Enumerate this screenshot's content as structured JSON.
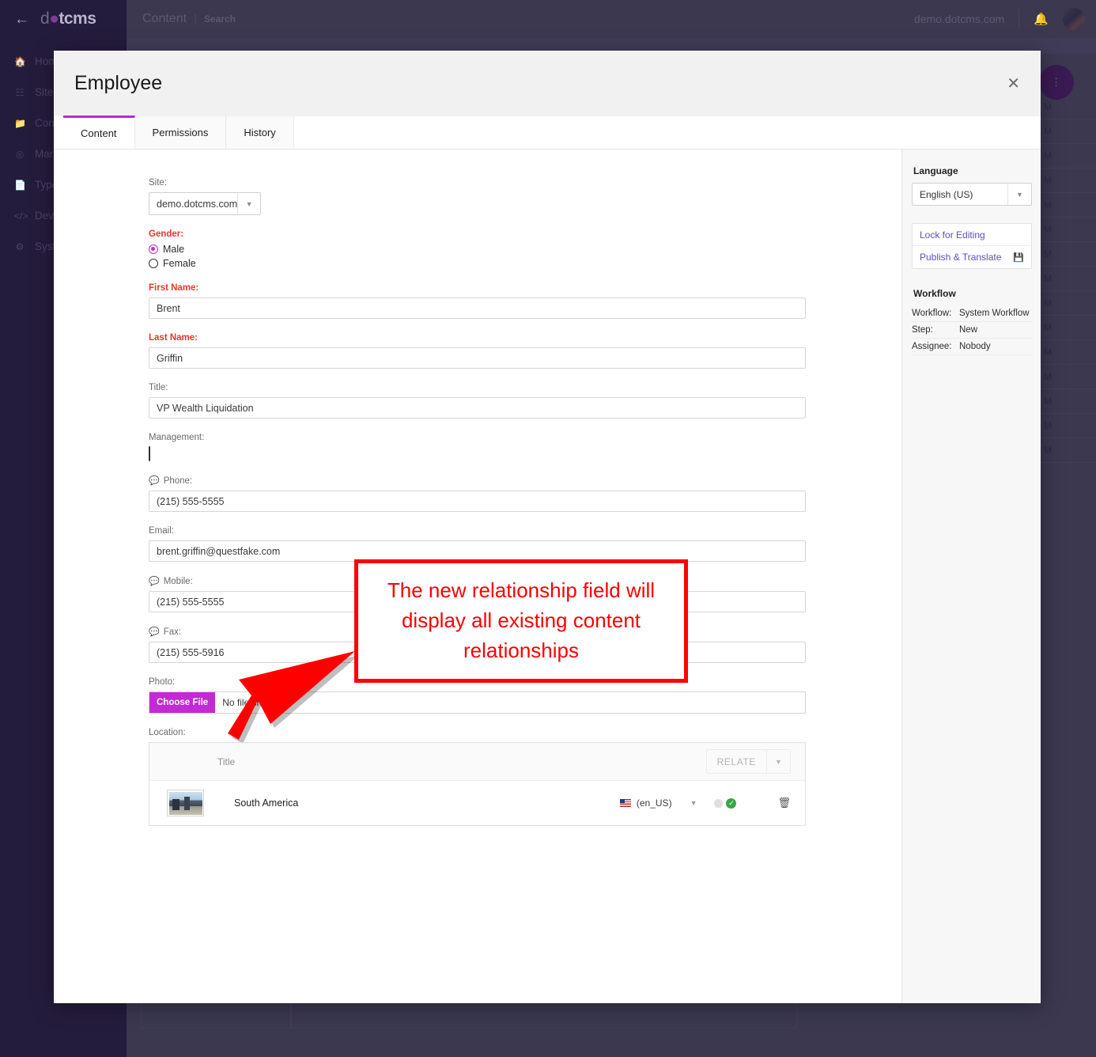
{
  "topbar": {
    "back_icon": "back-arrow-icon",
    "logo_text": "dotcms",
    "title": "Content",
    "separator": "|",
    "subtitle": "Search",
    "site": "demo.dotcms.com",
    "bell_icon": "bell-icon",
    "avatar": "user-avatar"
  },
  "sidebar": {
    "items": [
      {
        "label": "Home",
        "icon": "home-icon"
      },
      {
        "label": "Site",
        "icon": "sitemap-icon"
      },
      {
        "label": "Content",
        "icon": "folder-icon"
      },
      {
        "label": "Marketing",
        "icon": "target-icon"
      },
      {
        "label": "Types & Tags",
        "icon": "file-icon"
      },
      {
        "label": "Dev Tools",
        "icon": "code-icon"
      },
      {
        "label": "System",
        "icon": "gear-icon"
      }
    ]
  },
  "background_list": {
    "row_text": "M",
    "row_count": 15
  },
  "fab": {
    "icon": "more-vertical-icon",
    "color": "#3a1a52"
  },
  "modal": {
    "title": "Employee",
    "close_icon": "close-icon",
    "tabs": [
      {
        "label": "Content",
        "active": true
      },
      {
        "label": "Permissions",
        "active": false
      },
      {
        "label": "History",
        "active": false
      }
    ],
    "form": {
      "site": {
        "label": "Site:",
        "value": "demo.dotcms.com",
        "caret_icon": "chevron-down-icon"
      },
      "gender": {
        "label": "Gender:",
        "required": true,
        "options": [
          {
            "label": "Male",
            "selected": true
          },
          {
            "label": "Female",
            "selected": false
          }
        ]
      },
      "first_name": {
        "label": "First Name:",
        "required": true,
        "value": "Brent"
      },
      "last_name": {
        "label": "Last Name:",
        "required": true,
        "value": "Griffin"
      },
      "title": {
        "label": "Title:",
        "required": false,
        "value": "VP Wealth Liquidation"
      },
      "management": {
        "label": "Management:",
        "checked": false
      },
      "phone": {
        "label": "Phone:",
        "value": "(215) 555-5555",
        "icon": "comment-bubble-icon"
      },
      "email": {
        "label": "Email:",
        "value": "brent.griffin@questfake.com"
      },
      "mobile": {
        "label": "Mobile:",
        "value": "(215) 555-5555",
        "icon": "comment-bubble-icon"
      },
      "fax": {
        "label": "Fax:",
        "value": "(215) 555-5916",
        "icon": "comment-bubble-icon"
      },
      "photo": {
        "label": "Photo:",
        "button_label": "Choose File",
        "file_status": "No file chosen"
      },
      "location": {
        "label": "Location:",
        "column_title": "Title",
        "relate_label": "RELATE",
        "relate_caret_icon": "chevron-down-icon",
        "rows": [
          {
            "thumbnail": "city-skyline-thumbnail",
            "title": "South America",
            "language": "(en_US)",
            "flag_icon": "us-flag-icon",
            "lang_caret_icon": "chevron-down-icon",
            "status_dot": "gray-status-dot",
            "published_icon": "green-check-icon",
            "delete_icon": "trash-icon"
          }
        ]
      }
    },
    "sidepanel": {
      "language_heading": "Language",
      "language_value": "English (US)",
      "language_caret_icon": "chevron-down-icon",
      "actions": [
        {
          "label": "Lock for Editing",
          "icon": null
        },
        {
          "label": "Publish & Translate",
          "icon": "save-icon"
        }
      ],
      "workflow_heading": "Workflow",
      "workflow_rows": [
        {
          "key": "Workflow:",
          "value": "System Workflow"
        },
        {
          "key": "Step:",
          "value": "New"
        },
        {
          "key": "Assignee:",
          "value": "Nobody"
        }
      ]
    }
  },
  "annotation": {
    "text": "The new relationship field will display all existing content relationships",
    "color": "#ff0000",
    "arrow_icon": "red-arrow-icon"
  }
}
